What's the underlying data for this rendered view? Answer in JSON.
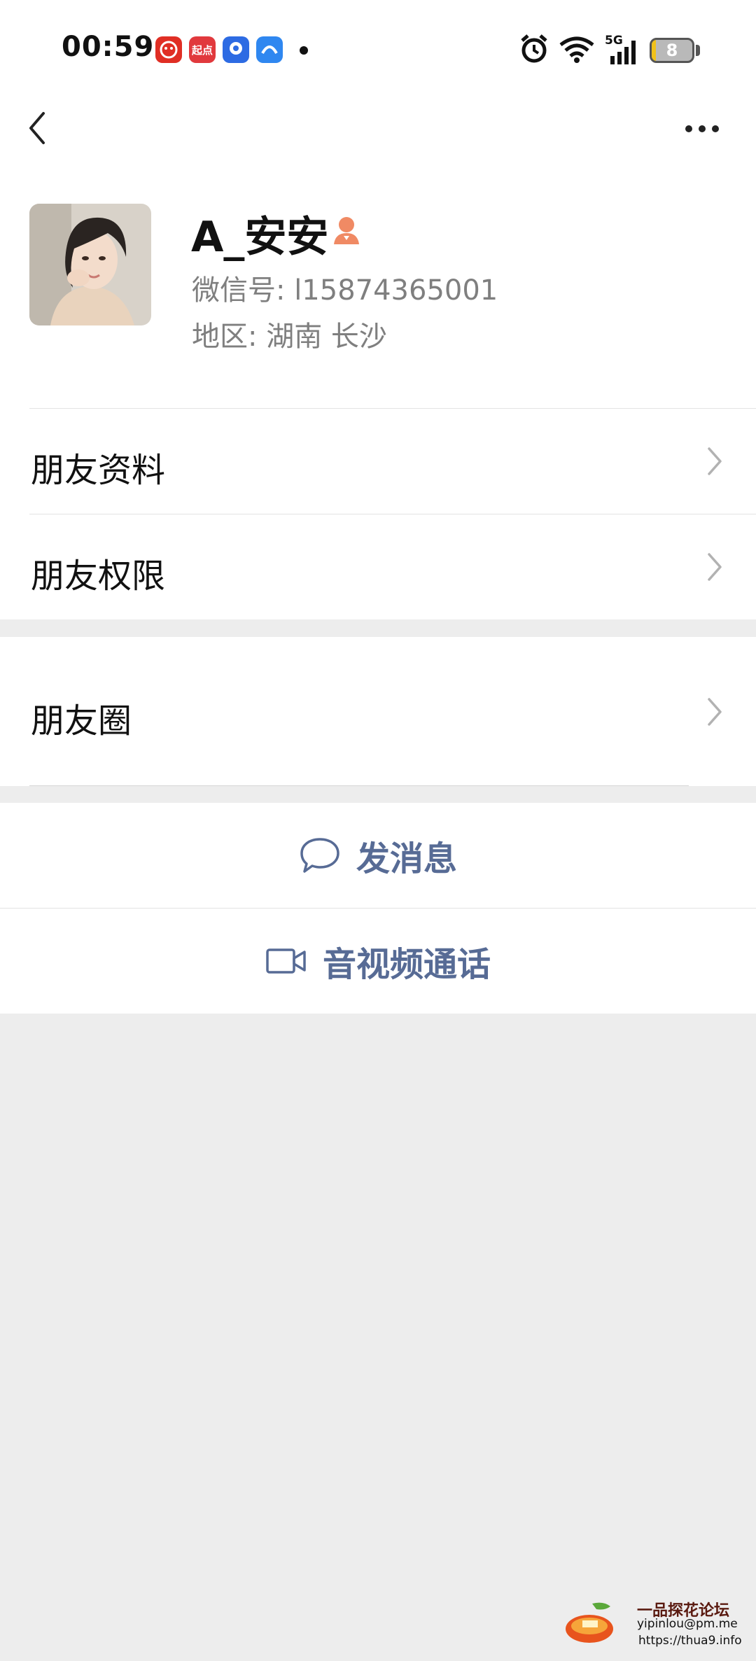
{
  "status_bar": {
    "time": "00:59",
    "apps": [
      {
        "icon": "pinduoduo-icon",
        "label": "",
        "color": "#e02e24"
      },
      {
        "icon": "qidian-icon",
        "label": "起点",
        "color": "#e1393d"
      },
      {
        "icon": "baidu-map-icon",
        "label": "",
        "color": "#2d6be3"
      },
      {
        "icon": "baidu-netdisk-icon",
        "label": "",
        "color": "#2f87f0"
      }
    ],
    "network": "5G",
    "battery_level": "8"
  },
  "nav": {
    "back_icon": "chevron-left-icon",
    "more_icon": "more-dots-icon"
  },
  "profile": {
    "name": "A_安安",
    "tag_icon": "person-tag-icon",
    "wechat_id": "微信号: l15874365001",
    "region": "地区: 湖南  长沙"
  },
  "menu": {
    "friend_info": "朋友资料",
    "friend_permissions": "朋友权限",
    "moments": "朋友圈"
  },
  "actions": {
    "send_message": "发消息",
    "video_call": "音视频通话"
  },
  "watermark": {
    "title": "一品探花论坛",
    "email": "yipinlou@pm.me",
    "url": "https://thua9.info"
  },
  "colors": {
    "link": "#576b95",
    "background": "#ededed",
    "tag": "#f08a64"
  }
}
